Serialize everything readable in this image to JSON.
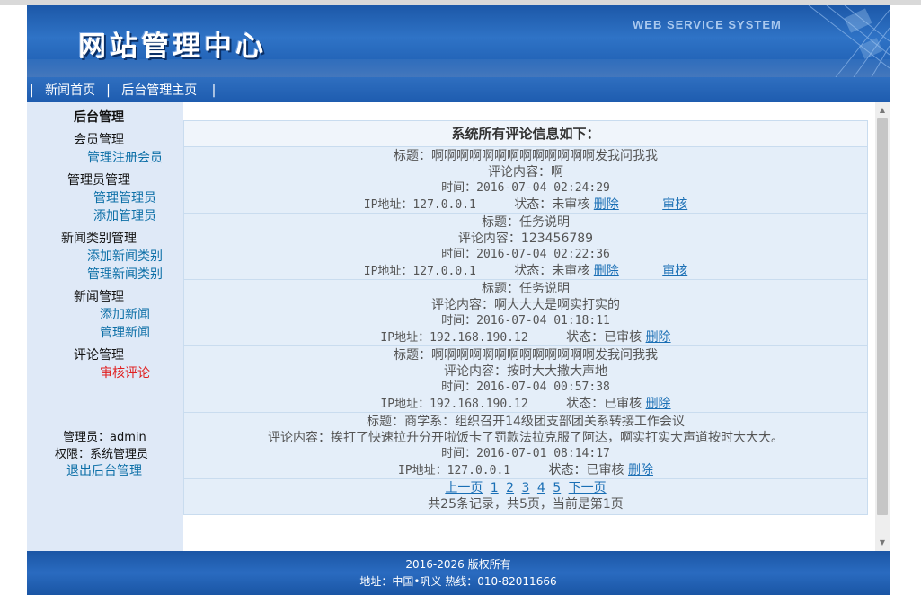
{
  "header": {
    "title": "网站管理中心",
    "subtitle": "WEB SERVICE SYSTEM"
  },
  "nav": {
    "items": [
      {
        "label": "新闻首页"
      },
      {
        "label": "后台管理主页"
      }
    ]
  },
  "sidebar": {
    "heading": "后台管理",
    "groups": [
      {
        "label": "会员管理",
        "links": [
          {
            "label": "管理注册会员"
          }
        ]
      },
      {
        "label": "管理员管理",
        "links": [
          {
            "label": "管理管理员"
          },
          {
            "label": "添加管理员"
          }
        ]
      },
      {
        "label": "新闻类别管理",
        "links": [
          {
            "label": "添加新闻类别"
          },
          {
            "label": "管理新闻类别"
          }
        ]
      },
      {
        "label": "新闻管理",
        "links": [
          {
            "label": "添加新闻"
          },
          {
            "label": "管理新闻"
          }
        ]
      },
      {
        "label": "评论管理",
        "links": [
          {
            "label": "审核评论"
          }
        ]
      }
    ],
    "admin_line": "管理员：admin",
    "role_line": "权限：系统管理员",
    "logout": "退出后台管理"
  },
  "main": {
    "caption": "系统所有评论信息如下：",
    "comments": [
      {
        "title": "标题：啊啊啊啊啊啊啊啊啊啊啊啊啊发我问我我",
        "content": "评论内容：啊",
        "time": "时间：2016-07-04 02:24:29",
        "ip": "IP地址：127.0.0.1",
        "status": "状态：未审核",
        "delete": "删除",
        "approve": "审核"
      },
      {
        "title": "标题：任务说明",
        "content": "评论内容：123456789",
        "time": "时间：2016-07-04 02:22:36",
        "ip": "IP地址：127.0.0.1",
        "status": "状态：未审核",
        "delete": "删除",
        "approve": "审核"
      },
      {
        "title": "标题：任务说明",
        "content": "评论内容：啊大大大是啊实打实的",
        "time": "时间：2016-07-04 01:18:11",
        "ip": "IP地址：192.168.190.12",
        "status": "状态：已审核",
        "delete": "删除"
      },
      {
        "title": "标题：啊啊啊啊啊啊啊啊啊啊啊啊啊发我问我我",
        "content": "评论内容：按时大大撒大声地",
        "time": "时间：2016-07-04 00:57:38",
        "ip": "IP地址：192.168.190.12",
        "status": "状态：已审核",
        "delete": "删除"
      },
      {
        "title": "标题：商学系：组织召开14级团支部团关系转接工作会议",
        "content": "评论内容：挨打了快速拉升分开啦饭卡了罚款法拉克服了阿达，啊实打实大声道按时大大大。",
        "time": "时间：2016-07-01 08:14:17",
        "ip": "IP地址：127.0.0.1",
        "status": "状态：已审核",
        "delete": "删除"
      }
    ],
    "pager": {
      "prev": "上一页",
      "pages": [
        "1",
        "2",
        "3",
        "4",
        "5"
      ],
      "next": "下一页",
      "summary": "共25条记录，共5页，当前是第1页"
    }
  },
  "footer": {
    "copyright": "2016-2026 版权所有",
    "address": "地址：中国•巩义 热线：010-82011666"
  }
}
